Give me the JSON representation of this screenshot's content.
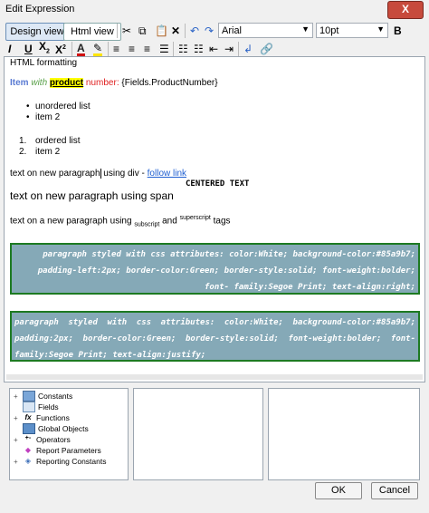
{
  "window": {
    "title": "Edit Expression",
    "close_label": "X"
  },
  "toolbar": {
    "design_view": "Design view",
    "html_view": "Html view",
    "font": "Arial",
    "size": "10pt",
    "bold": "B"
  },
  "editor": {
    "heading": "HTML formatting",
    "field_line": {
      "item": "Item",
      "with": "with",
      "product": "product",
      "number": "number:",
      "fields": "{Fields.ProductNumber}"
    },
    "unordered": [
      "unordered list",
      "item 2"
    ],
    "ordered": [
      {
        "n": "1.",
        "text": "ordered list"
      },
      {
        "n": "2.",
        "text": "item 2"
      }
    ],
    "div_line": {
      "text": "text on new paragraph",
      "rest": " using div - ",
      "link": "follow link"
    },
    "centered": "CENTERED TEXT",
    "span_line": "text on new paragraph using span",
    "sub_sup": {
      "pre": "text on a new paragraph using ",
      "sub": "subscript",
      "mid": " and ",
      "sup": "superscript",
      "post": " tags"
    },
    "styled_right": "paragraph styled with css attributes: color:White; background-color:#85a9b7; padding-left:2px; border-color:Green; border-style:solid; font-weight:bolder; font- family:Segoe Print; text-align:right;",
    "styled_justify": "paragraph styled with css attributes: color:White; background-color:#85a9b7; padding:2px; border-color:Green; border-style:solid; font-weight:bolder; font-family:Segoe Print; text-align:justify;"
  },
  "tree": [
    {
      "label": "Constants",
      "expand": "+"
    },
    {
      "label": "Fields",
      "expand": ""
    },
    {
      "label": "Functions",
      "expand": "+"
    },
    {
      "label": "Global Objects",
      "expand": ""
    },
    {
      "label": "Operators",
      "expand": "+"
    },
    {
      "label": "Report Parameters",
      "expand": ""
    },
    {
      "label": "Reporting Constants",
      "expand": "+"
    }
  ],
  "buttons": {
    "ok": "OK",
    "cancel": "Cancel"
  },
  "colors": {
    "styled_bg": "#85a9b7",
    "styled_border": "#1d7a22"
  }
}
